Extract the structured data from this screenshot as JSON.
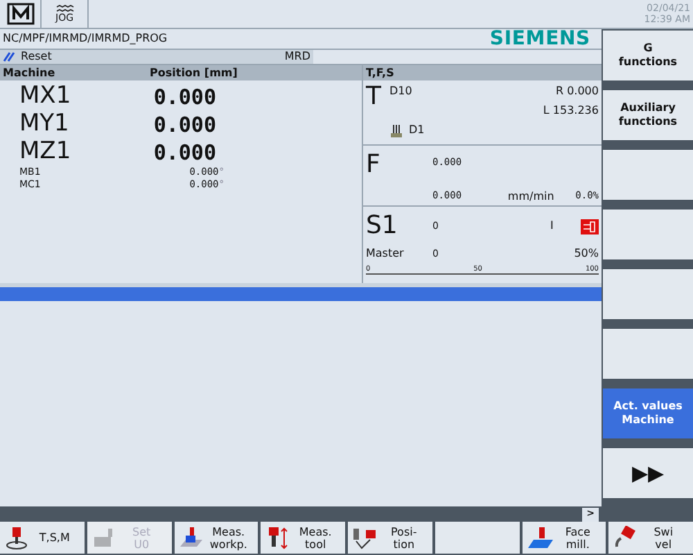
{
  "header": {
    "mode": "JOG",
    "date": "02/04/21",
    "time": "12:39 AM"
  },
  "path": "NC/MPF/IMRMD/IMRMD_PROG",
  "brand": "SIEMENS",
  "status": {
    "reset": "Reset",
    "mrd": "MRD"
  },
  "axes_panel": {
    "columns": [
      "Machine",
      "Position [mm]"
    ],
    "axes": [
      {
        "name": "MX1",
        "value": "0.000",
        "kind": "large"
      },
      {
        "name": "MY1",
        "value": "0.000",
        "kind": "large"
      },
      {
        "name": "MZ1",
        "value": "0.000",
        "kind": "large"
      },
      {
        "name": "MB1",
        "value": "0.000",
        "unit": "°",
        "kind": "small"
      },
      {
        "name": "MC1",
        "value": "0.000",
        "unit": "°",
        "kind": "small"
      }
    ]
  },
  "tfs_panel": {
    "title": "T,F,S",
    "tool": {
      "letter": "T",
      "name": "D10",
      "radius": "R 0.000",
      "length": "L 153.236",
      "edge": "D1"
    },
    "feed": {
      "letter": "F",
      "value": "0.000",
      "actual": "0.000",
      "unit": "mm/min",
      "override": "0.0%"
    },
    "spindle": {
      "letter": "S1",
      "value": "0",
      "gear": "I",
      "role": "Master",
      "actual": "0",
      "override": "50%",
      "scale": [
        "0",
        "50",
        "100"
      ]
    }
  },
  "vertical_softkeys": [
    {
      "label": "G\nfunctions",
      "selected": false
    },
    {
      "label": "Auxiliary\nfunctions",
      "selected": false
    },
    {
      "selected": false
    },
    {
      "selected": false
    },
    {
      "selected": false
    },
    {
      "selected": false
    },
    {
      "label": "Act. values\nMachine",
      "selected": true
    },
    {
      "label": "▶▶",
      "selected": false
    }
  ],
  "more_button": ">",
  "horizontal_softkeys": [
    {
      "kind": "key",
      "label": "T,S,M",
      "disabled": false
    },
    {
      "kind": "key",
      "label": "Set\nU0",
      "disabled": true
    },
    {
      "kind": "key",
      "label": "Meas.\nworkp.",
      "disabled": false
    },
    {
      "kind": "key",
      "label": "Meas.\ntool",
      "disabled": false
    },
    {
      "kind": "key",
      "label": "Posi-\ntion",
      "disabled": false
    },
    {
      "kind": "blank"
    },
    {
      "kind": "key",
      "label": "Face\nmill.",
      "disabled": false
    },
    {
      "kind": "key",
      "label": "Swi\nvel",
      "disabled": false
    }
  ]
}
